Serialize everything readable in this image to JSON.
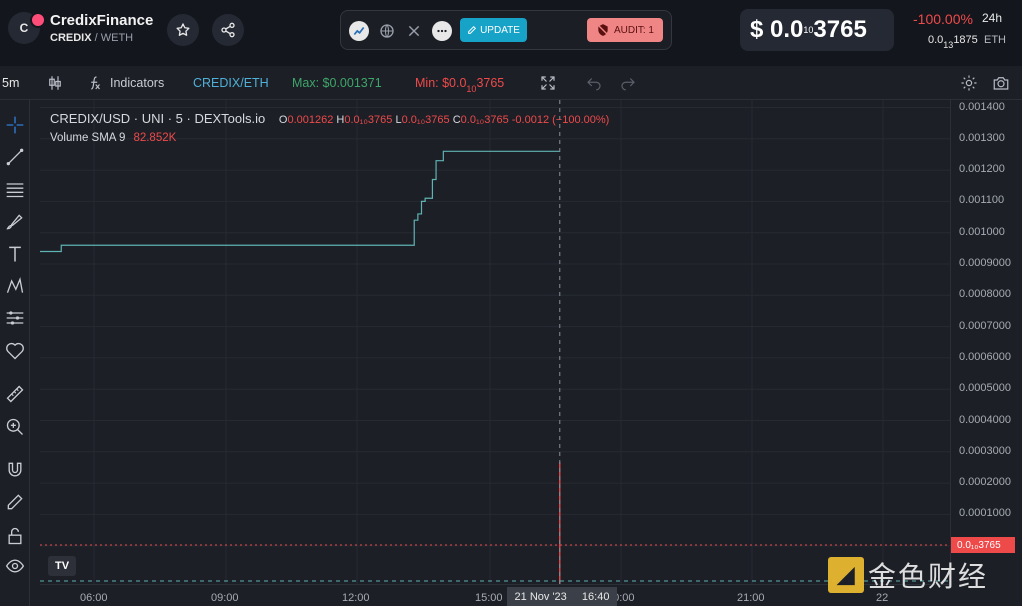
{
  "header": {
    "logo_letter": "C",
    "token_name": "CredixFinance",
    "base_symbol": "CREDIX",
    "quote_symbol": "/ WETH",
    "update_label": "UPDATE",
    "audit_label": "AUDIT: 1",
    "price_prefix": "$ 0.0",
    "price_zeros": "10",
    "price_suffix": "3765",
    "change_pct": "-100.00%",
    "period": "24h",
    "eth_price_prefix": "0.0",
    "eth_price_zeros": "13",
    "eth_price_suffix": "1875",
    "eth_label": "ETH"
  },
  "toolbar": {
    "interval": "5m",
    "indicators_label": "Indicators",
    "pair_label": "CREDIX/ETH",
    "max_label": "Max: $0.001371",
    "min_prefix": "Min: $0.0",
    "min_zeros": "10",
    "min_suffix": "3765"
  },
  "legend": {
    "title": "CREDIX/USD · UNI · 5 · DEXTools.io",
    "o_label": "O",
    "o_value": "0.001262",
    "h_label": "H",
    "h_value": "0.0₁₀3765",
    "l_label": "L",
    "l_value": "0.0₁₀3765",
    "c_label": "C",
    "c_value": "0.0₁₀3765",
    "change": "-0.0012 (−100.00%)",
    "volume_label": "Volume SMA 9",
    "volume_value": "82.852K"
  },
  "axes": {
    "y_ticks": [
      "0.001400",
      "0.001300",
      "0.001200",
      "0.001100",
      "0.001000",
      "0.0009000",
      "0.0008000",
      "0.0007000",
      "0.0006000",
      "0.0005000",
      "0.0004000",
      "0.0003000",
      "0.0002000",
      "0.0001000"
    ],
    "x_ticks": [
      "06:00",
      "09:00",
      "12:00",
      "15:00",
      "20:00",
      "21:00",
      "22"
    ],
    "price_tag": "0.0₁₀3765",
    "cross_date": "21 Nov '23",
    "cross_time": "16:40"
  },
  "chart_data": {
    "type": "line",
    "title": "CREDIX/USD · UNI · 5 · DEXTools.io",
    "ylim": [
      0,
      0.0014
    ],
    "x_labels": [
      "06:00",
      "09:00",
      "12:00",
      "15:00",
      "20:00",
      "21:00",
      "22"
    ],
    "series": [
      {
        "name": "CREDIX/USD",
        "x": [
          "04:50",
          "05:10",
          "05:15",
          "13:15",
          "13:20",
          "13:25",
          "13:30",
          "13:35",
          "13:45",
          "13:50",
          "13:55",
          "14:00",
          "16:40"
        ],
        "values": [
          0.00094,
          0.00094,
          0.00096,
          0.00096,
          0.00104,
          0.00106,
          0.0011,
          0.00111,
          0.00117,
          0.00123,
          0.00123,
          0.00126,
          0.00126
        ]
      },
      {
        "name": "crash",
        "x": [
          "16:40"
        ],
        "values": [
          3.765e-13
        ]
      }
    ],
    "colors": {
      "line": "#5fb3b3",
      "down": "#ef4a4a"
    }
  },
  "watermark": {
    "box_glyph": "◢",
    "text": "金色财经"
  },
  "tv_logo": "TV"
}
